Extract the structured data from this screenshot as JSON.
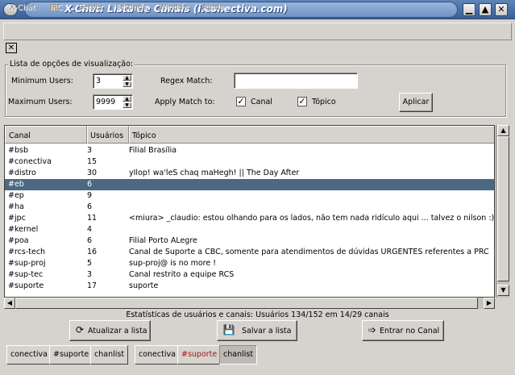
{
  "window": {
    "title": "X-Chat: Lista de Canais (i.conectiva.com)",
    "minimize": "▁",
    "maximize": "▲",
    "close": "✕"
  },
  "menu": [
    "X-Chat",
    "IRC",
    "Server",
    "Settings",
    "Window",
    "Ajuda"
  ],
  "close_button": "✕",
  "options": {
    "group_title": "Lista de opções de visualização:",
    "min_users_label": "Minimum Users:",
    "min_users_value": "3",
    "max_users_label": "Maximum Users:",
    "max_users_value": "9999",
    "regex_label": "Regex Match:",
    "regex_value": "",
    "apply_label": "Apply Match to:",
    "canal_label": "Canal",
    "canal_checked": "✓",
    "topico_label": "Tópico",
    "topico_checked": "✓",
    "apply_button": "Aplicar"
  },
  "list": {
    "headers": [
      "Canal",
      "Usuários",
      "Tópico"
    ],
    "rows": [
      {
        "canal": "#bsb",
        "users": "3",
        "topic": "Filial Brasília"
      },
      {
        "canal": "#conectiva",
        "users": "15",
        "topic": ""
      },
      {
        "canal": "#distro",
        "users": "30",
        "topic": "yIlop! wa'leS chaq maHegh! || The Day After"
      },
      {
        "canal": "#eb",
        "users": "6",
        "topic": ""
      },
      {
        "canal": "#ep",
        "users": "9",
        "topic": ""
      },
      {
        "canal": "#ha",
        "users": "6",
        "topic": ""
      },
      {
        "canal": "#jpc",
        "users": "11",
        "topic": "<miura> _claudio: estou olhando para os lados, não tem nada ridículo aqui ... talvez o nilson :)"
      },
      {
        "canal": "#kernel",
        "users": "4",
        "topic": ""
      },
      {
        "canal": "#poa",
        "users": "6",
        "topic": "Filial Porto ALegre"
      },
      {
        "canal": "#rcs-tech",
        "users": "16",
        "topic": "Canal de Suporte a CBC, somente para atendimentos de dúvidas URGENTES referentes a PRC"
      },
      {
        "canal": "#sup-proj",
        "users": "5",
        "topic": "sup-proj@ is no more !"
      },
      {
        "canal": "#sup-tec",
        "users": "3",
        "topic": "Canal restrito a equipe RCS"
      },
      {
        "canal": "#suporte",
        "users": "17",
        "topic": "suporte"
      }
    ],
    "selected_index": 3
  },
  "stats": "Estatísticas de usuários e canais: Usuários 134/152 em 14/29 canais",
  "buttons": {
    "refresh": "Atualizar a lista",
    "save": "Salvar a lista",
    "join": "Entrar no Canal"
  },
  "tabs": [
    "conectiva",
    "#suporte",
    "chanlist",
    "conectiva",
    "#suporte",
    "chanlist"
  ],
  "colors": {
    "selection": "#4b6983",
    "titlebar": "#3a5f97",
    "highlight_tab": "#a4161a"
  }
}
